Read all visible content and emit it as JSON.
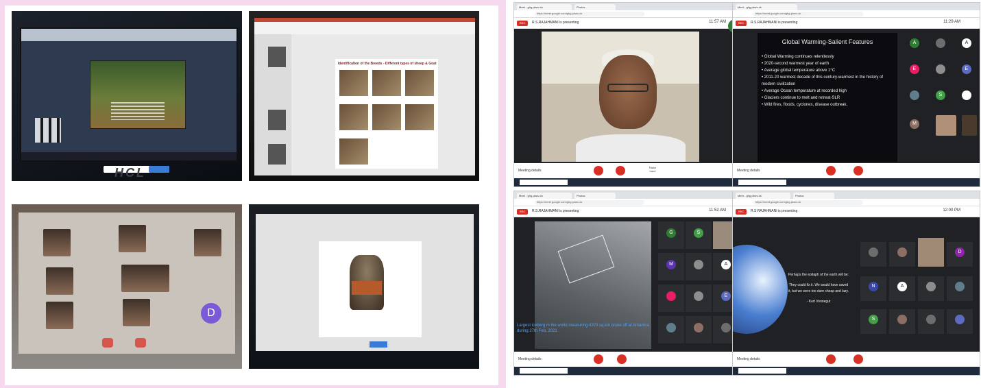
{
  "collage": {
    "photo1": {
      "brand": "HCL",
      "present_button": "Stop sharing"
    },
    "photo2": {
      "slide_heading": "Identification of the Breeds - Different types of sheep & Goat"
    },
    "photo3": {
      "avatar_letter": "D"
    },
    "photo4": {
      "present_button": "Stop sharing"
    }
  },
  "meet1": {
    "tabs": [
      "Meet - ghg-pkwv-ck",
      "Photos"
    ],
    "url": "https://meet.google.com/ghg-pkwv-ck",
    "rec": "REC",
    "presenter": "R.S.RAJAHMANI is presenting",
    "clock": "11:57 AM",
    "meeting_details": "Meeting details",
    "present_label": "Raise hand"
  },
  "meet2": {
    "tabs": [
      "Meet - ghg-pkwv-ck"
    ],
    "url": "https://meet.google.com/ghg-pkwv-ck",
    "rec": "REC",
    "presenter": "R.S.RAJAHMANI is presenting",
    "clock": "11:29 AM",
    "slide": {
      "title": "Global Warming-Salient Features",
      "bullets": [
        "Global Warming continues relentlessly",
        "2020-second warmest year of earth",
        "Average global temperature above 1°C",
        "2011-20 warmest decade of this century-warmest in the history of modern civilization",
        "Average Ocean temperature at recorded high",
        "Glaciers continue to melt and retreat-SLR",
        "Wild fires, floods, cyclones, disease outbreak,"
      ]
    },
    "avatars": [
      "A",
      "",
      "A",
      "E",
      "",
      "E",
      "",
      "S",
      "",
      "M",
      "",
      ""
    ],
    "meeting_details": "Meeting details"
  },
  "meet3": {
    "tabs": [
      "Meet - ghg-pkwv-ck",
      "Photos"
    ],
    "url": "https://meet.google.com/ghg-pkwv-ck",
    "rec": "REC",
    "presenter": "R.S.RAJAHMANI is presenting",
    "clock": "11:52 AM",
    "caption": "Largest iceberg in the world measuring 4323 sq.km broke off at Antartica during 27th Feb, 2021",
    "avatars": [
      "G",
      "S",
      "",
      "M",
      "",
      "A",
      "",
      "",
      "E",
      "",
      "",
      ""
    ],
    "meeting_details": "Meeting details"
  },
  "meet4": {
    "tabs": [
      "Meet - ghg-pkwv-ck",
      "Photos"
    ],
    "url": "https://meet.google.com/ghg-pkwv-ck",
    "rec": "REC",
    "presenter": "R.S.RAJAHMANI is presenting",
    "clock": "12:00 PM",
    "quote_1": "Perhaps the epitaph of the earth will be:",
    "quote_2": "They could fix it. We would have saved it, but we were too darn cheap and lazy.",
    "quote_by": "- Kurt Vonnegut",
    "avatars": [
      "",
      "",
      "",
      "D",
      "N",
      "A",
      "",
      "",
      "S",
      "",
      "",
      ""
    ],
    "meeting_details": "Meeting details"
  }
}
